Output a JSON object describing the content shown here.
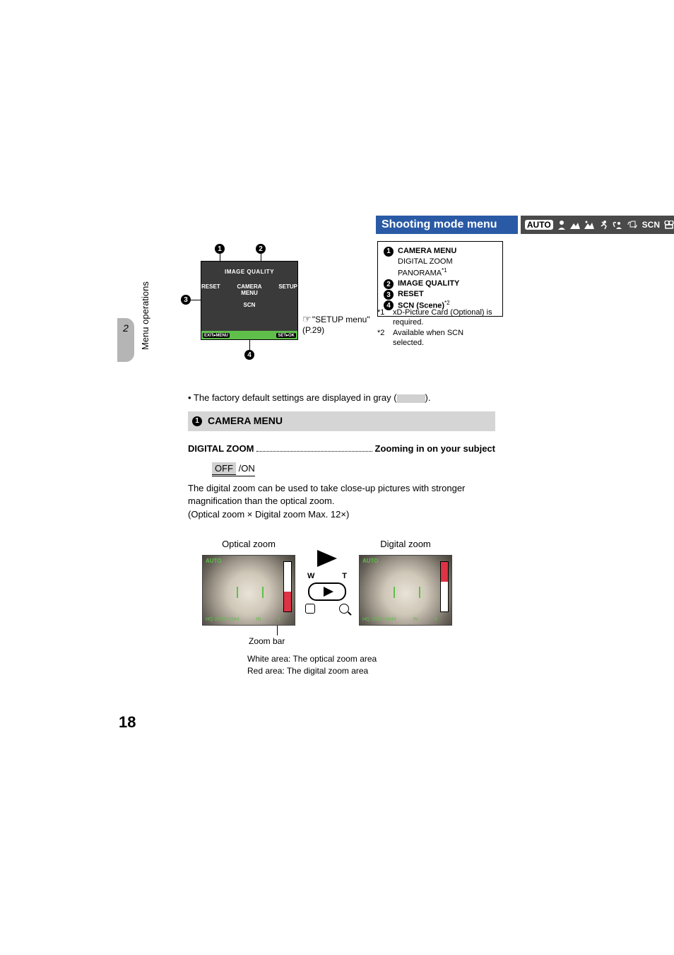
{
  "header": {
    "title": "Shooting mode menu",
    "mode_icons": {
      "auto_label": "AUTO",
      "scn_label": "SCN"
    }
  },
  "menu_screen": {
    "top": "IMAGE QUALITY",
    "left": "RESET",
    "center": "CAMERA MENU",
    "right": "SETUP",
    "bottom": "SCN",
    "bar_left": "EXIT▸MENU",
    "bar_right": "SET▸OK"
  },
  "setup_ref": {
    "label": "\"SETUP menu\"",
    "page": "(P.29)"
  },
  "callouts": {
    "c1": "1",
    "c2": "2",
    "c3": "3",
    "c4": "4"
  },
  "legend": {
    "r1": {
      "num": "1",
      "title": "CAMERA MENU",
      "sub1": "DIGITAL ZOOM",
      "sub2": "PANORAMA",
      "sup": "*1"
    },
    "r2": {
      "num": "2",
      "title": "IMAGE QUALITY"
    },
    "r3": {
      "num": "3",
      "title": "RESET"
    },
    "r4": {
      "num": "4",
      "title": "SCN (Scene)",
      "sup": "*2"
    }
  },
  "footnotes": {
    "f1": {
      "lbl": "*1",
      "text": "xD-Picture Card (Optional) is required."
    },
    "f2": {
      "lbl": "*2",
      "text": "Available when SCN selected."
    }
  },
  "side": {
    "chapter": "2",
    "label": "Menu operations"
  },
  "factory_note": {
    "prefix": "• The factory default settings are displayed in gray (",
    "suffix": ")."
  },
  "section1": {
    "num": "1",
    "title": "CAMERA MENU"
  },
  "digital_zoom": {
    "heading": "DIGITAL ZOOM",
    "desc": "Zooming in on your subject",
    "off": "OFF",
    "on": " /ON",
    "body1": "The digital zoom can be used to take close-up pictures with stronger magnification than the optical zoom.",
    "body2": "(Optical zoom × Digital zoom  Max. 12×)"
  },
  "zoom": {
    "optical_caption": "Optical zoom",
    "digital_caption": "Digital zoom",
    "w": "W",
    "t": "T",
    "screen_mode": "AUTO",
    "screen_info_left": "HQ  2592×1944",
    "screen_info_right": "4",
    "screen_in": "IN",
    "zb_label": "Zoom bar",
    "note_white": "White area: The optical zoom area",
    "note_red": "Red area: The digital zoom area"
  },
  "page_number": "18"
}
